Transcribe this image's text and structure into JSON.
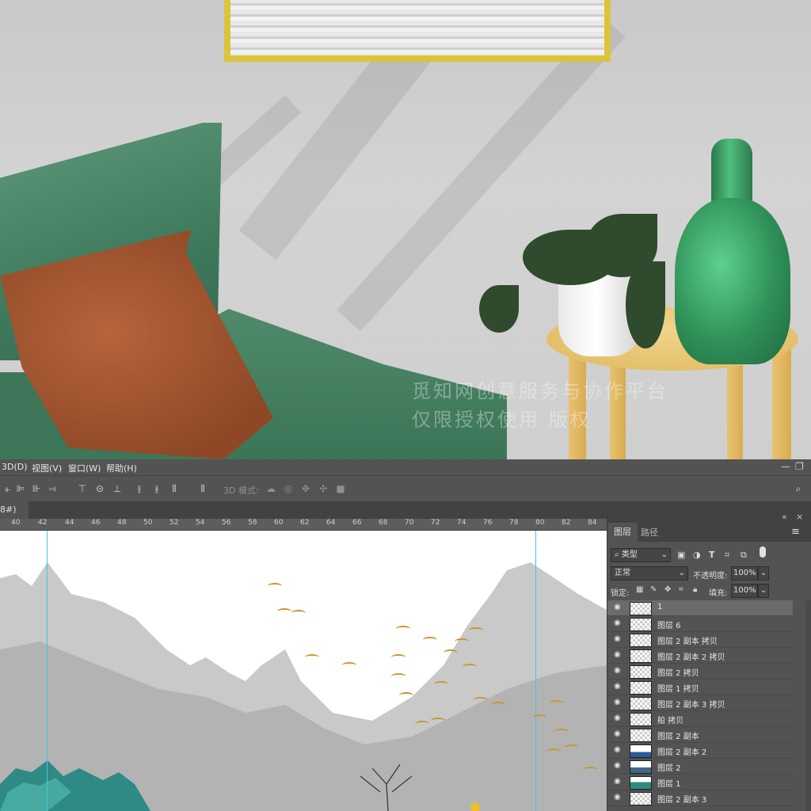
{
  "watermark": {
    "line1": "觅知网创意服务与协作平台",
    "line2": "仅限授权使用 版权"
  },
  "menu": [
    {
      "label": "3D(D)"
    },
    {
      "label": "视图(V)"
    },
    {
      "label": "窗口(W)"
    },
    {
      "label": "帮助(H)"
    }
  ],
  "window_controls": {
    "minimize": "—",
    "restore": "❐"
  },
  "options_bar": {
    "mode_label": "3D 模式:"
  },
  "document_tab": {
    "label": "8#)",
    "close": "×"
  },
  "ruler": {
    "ticks": [
      "40",
      "42",
      "44",
      "46",
      "48",
      "50",
      "52",
      "54",
      "56",
      "58",
      "60",
      "62",
      "64",
      "66",
      "68",
      "70",
      "72",
      "74",
      "76",
      "78",
      "80",
      "82",
      "84"
    ]
  },
  "panel": {
    "collapse": "«",
    "close": "×",
    "tabs": [
      "图层",
      "路径"
    ],
    "menu_icon": "≡",
    "filter_kind": "类型",
    "blend_mode": "正常",
    "opacity_label": "不透明度:",
    "opacity_value": "100%",
    "lock_label": "锁定:",
    "fill_label": "填充:",
    "fill_value": "100%"
  },
  "layers": [
    {
      "name": "1",
      "selected": true
    },
    {
      "name": "图层 6"
    },
    {
      "name": "图层 2 副本 拷贝"
    },
    {
      "name": "图层 2 副本 2 拷贝"
    },
    {
      "name": "图层 2 拷贝"
    },
    {
      "name": "图层 1 拷贝"
    },
    {
      "name": "图层 2 副本 3 拷贝"
    },
    {
      "name": "船 拷贝"
    },
    {
      "name": "图层 2 副本"
    },
    {
      "name": "图层 2 副本 2"
    },
    {
      "name": "图层 2"
    },
    {
      "name": "图层 1"
    },
    {
      "name": "图层 2 副本 3"
    }
  ]
}
